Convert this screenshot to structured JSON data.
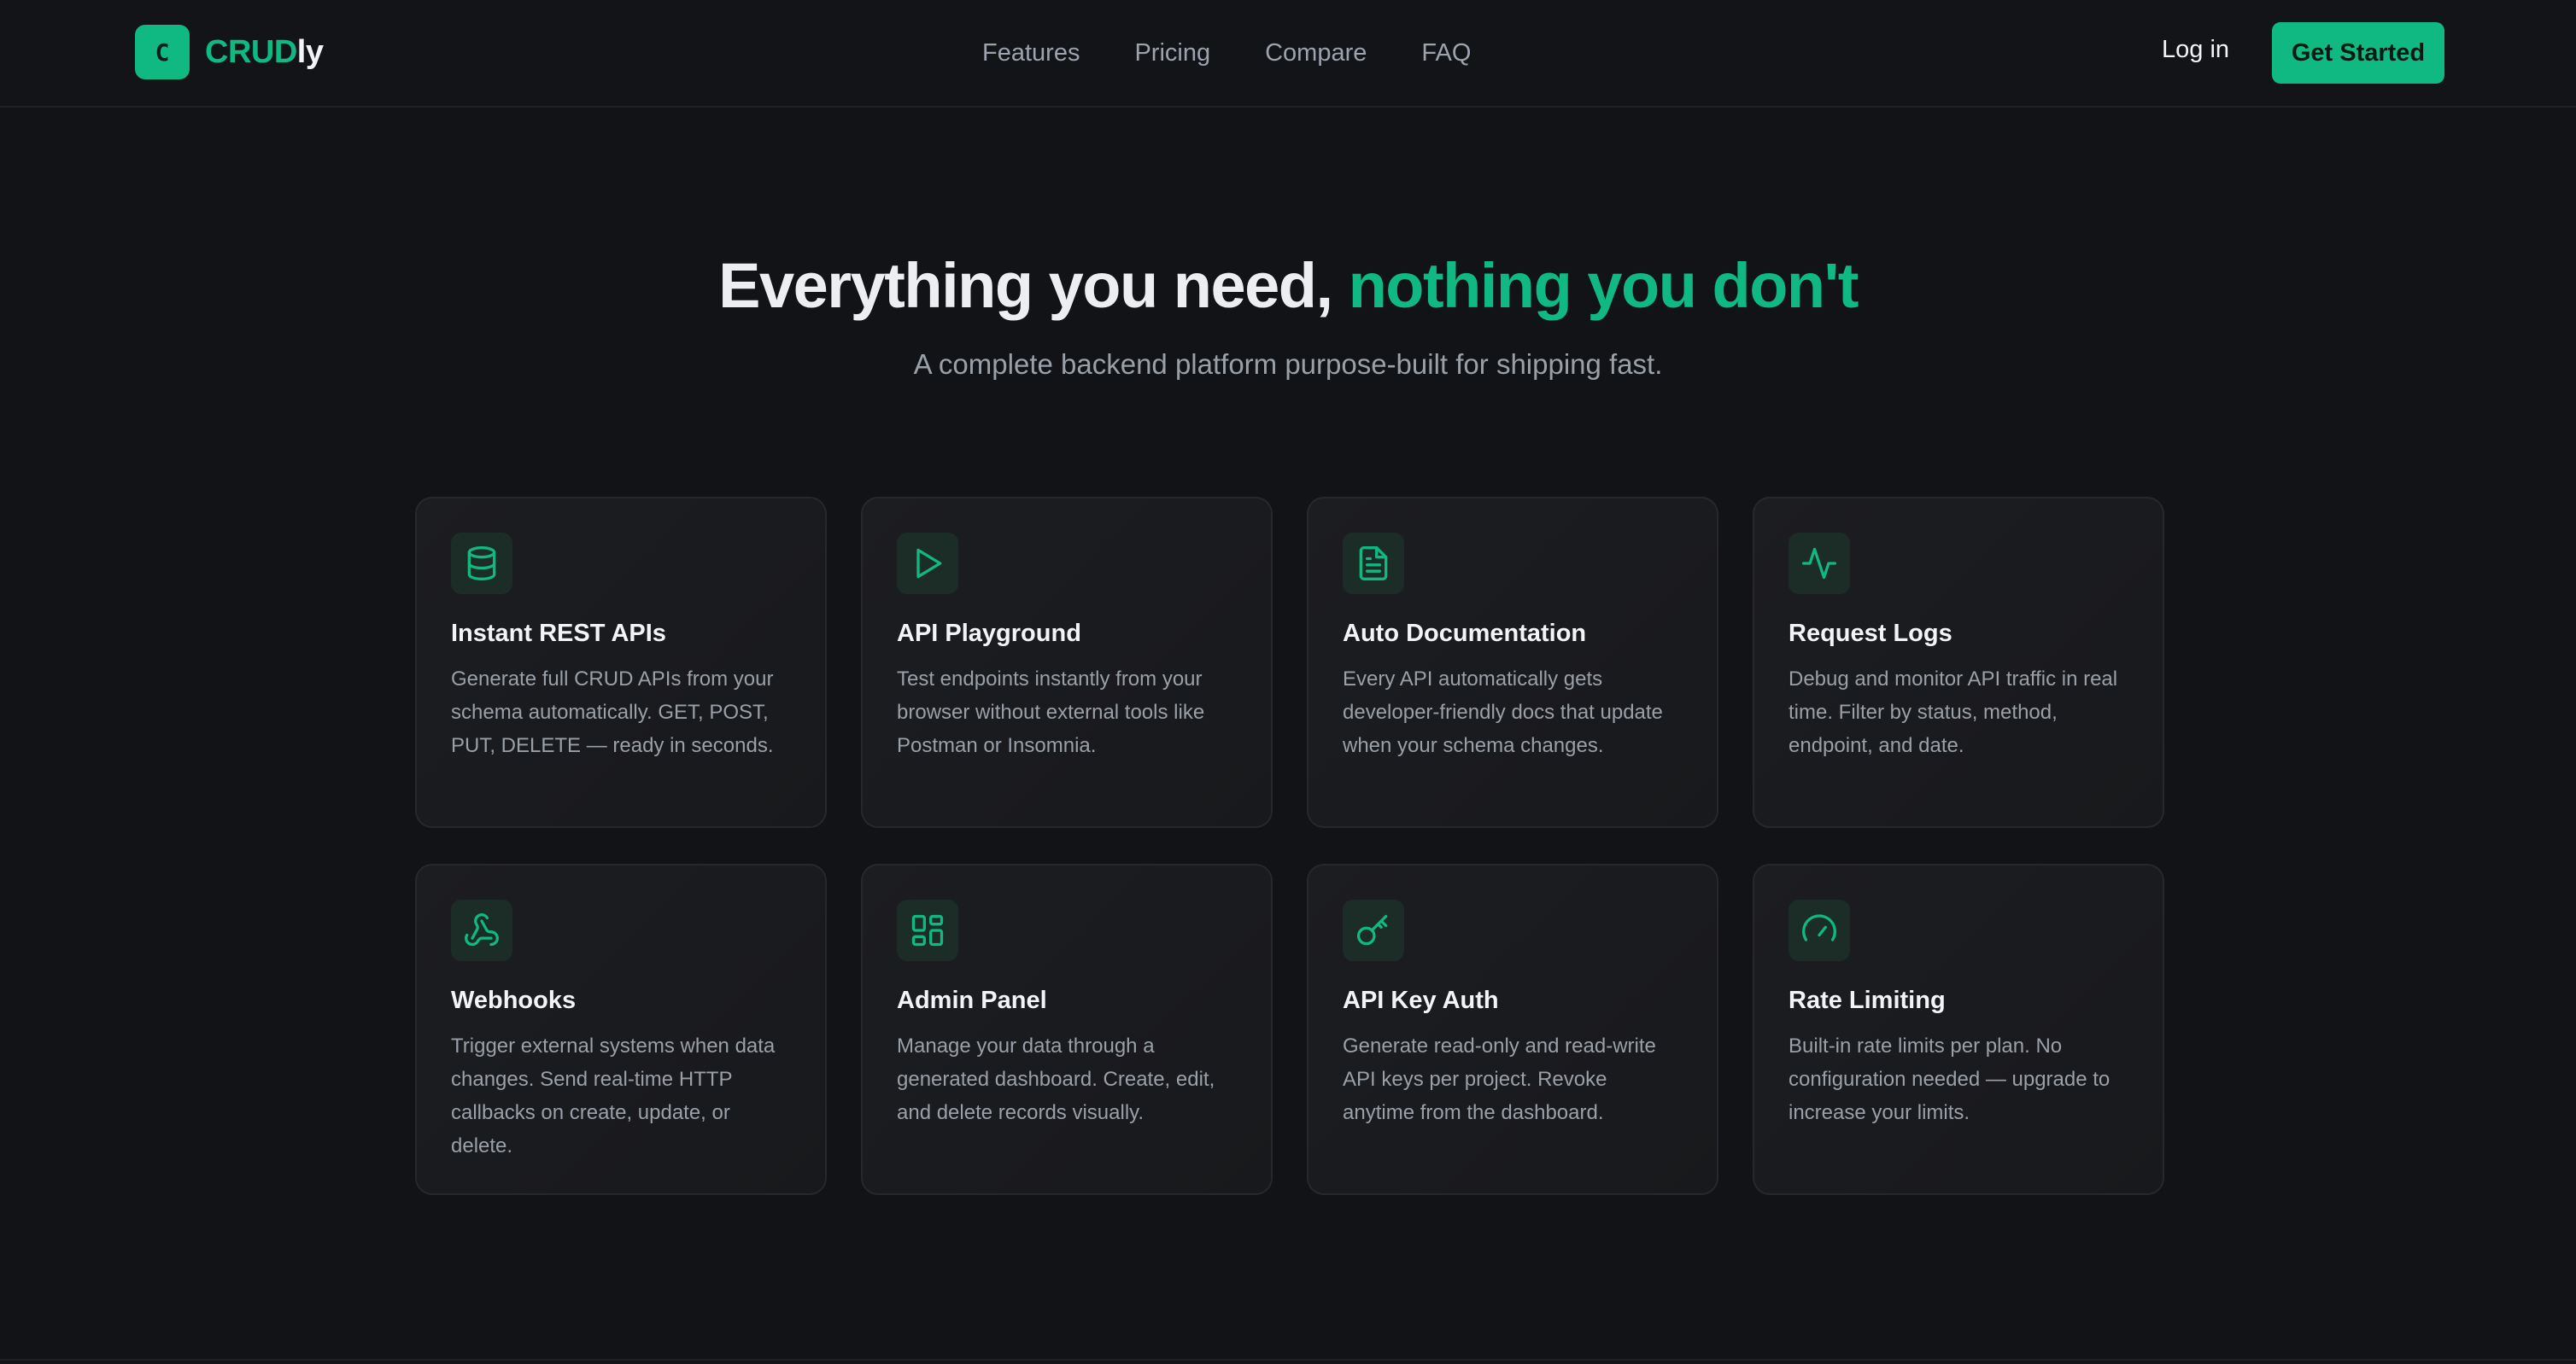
{
  "nav": {
    "brand_mark": "C",
    "brand_name_accent": "CRUD",
    "brand_name_rest": "ly",
    "links": [
      "Features",
      "Pricing",
      "Compare",
      "FAQ"
    ],
    "login_label": "Log in",
    "cta_label": "Get Started"
  },
  "hero": {
    "title_plain": "Everything you need, ",
    "title_accent": "nothing you don't",
    "subtitle": "A complete backend platform purpose-built for shipping fast."
  },
  "features": [
    {
      "icon": "database-icon",
      "title": "Instant REST APIs",
      "desc": "Generate full CRUD APIs from your schema automatically. GET, POST, PUT, DELETE — ready in seconds."
    },
    {
      "icon": "play-icon",
      "title": "API Playground",
      "desc": "Test endpoints instantly from your browser without external tools like Postman or Insomnia."
    },
    {
      "icon": "document-icon",
      "title": "Auto Documentation",
      "desc": "Every API automatically gets developer-friendly docs that update when your schema changes."
    },
    {
      "icon": "activity-icon",
      "title": "Request Logs",
      "desc": "Debug and monitor API traffic in real time. Filter by status, method, endpoint, and date."
    },
    {
      "icon": "webhook-icon",
      "title": "Webhooks",
      "desc": "Trigger external systems when data changes. Send real-time HTTP callbacks on create, update, or delete."
    },
    {
      "icon": "dashboard-icon",
      "title": "Admin Panel",
      "desc": "Manage your data through a generated dashboard. Create, edit, and delete records visually."
    },
    {
      "icon": "key-icon",
      "title": "API Key Auth",
      "desc": "Generate read-only and read-write API keys per project. Revoke anytime from the dashboard."
    },
    {
      "icon": "gauge-icon",
      "title": "Rate Limiting",
      "desc": "Built-in rate limits per plan. No configuration needed — upgrade to increase your limits."
    }
  ],
  "colors": {
    "accent": "#10b981",
    "background": "#121316",
    "card": "#1b1c20",
    "muted_text": "#9aa0a8"
  }
}
